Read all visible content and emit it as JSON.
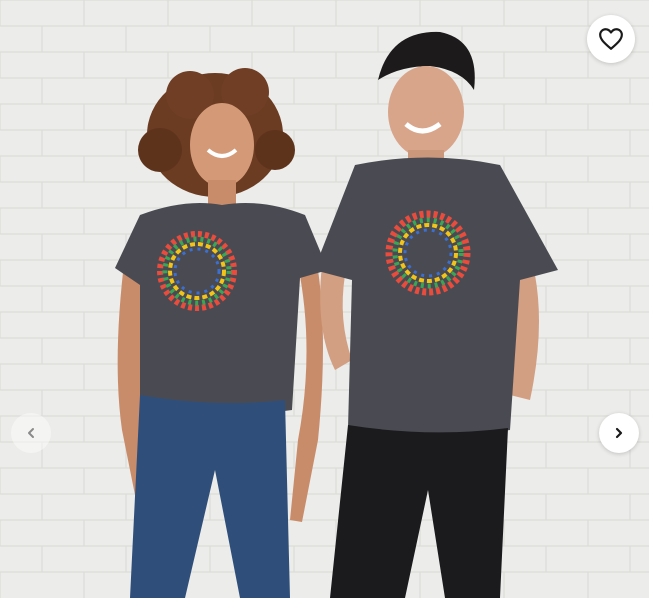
{
  "product_image": {
    "icons": {
      "favorite": "heart-outline-icon",
      "previous": "chevron-left-icon",
      "next": "chevron-right-icon"
    },
    "colors": {
      "wall": "#ececea",
      "shirt": "#4a4b52",
      "jeans": "#2f4f7a",
      "pants": "#1b1b1d",
      "button_bg": "#ffffff",
      "icon": "#1a1a1a"
    }
  }
}
